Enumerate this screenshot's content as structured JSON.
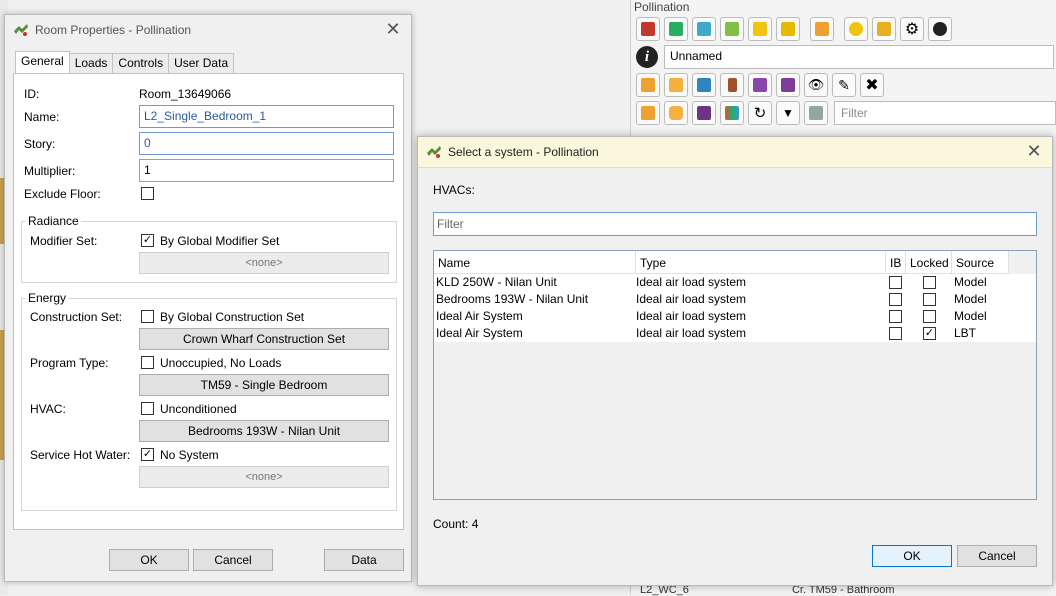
{
  "background": {
    "panel_title": "Pollination",
    "name_value": "Unnamed",
    "filter_placeholder": "Filter",
    "bottom_row_label": "L2_WC_6",
    "bottom_row_program": "Cr. TM59 - Bathroom",
    "toolbar_row1": [
      "room-icon",
      "face-icon",
      "aperture-icon",
      "shade-icon",
      "sensor-icon",
      "color-icon",
      "model-icon",
      "search-icon",
      "report-icon",
      "gear-icon",
      "help-book-icon"
    ],
    "toolbar_row2": [
      "add-room-icon",
      "add-face-icon",
      "add-aperture-icon",
      "add-door-icon",
      "add-shade-icon",
      "add-grid-icon",
      "view-icon",
      "edit-icon",
      "delete-icon"
    ],
    "toolbar_row3": [
      "room-select-icon",
      "hexagon-icon",
      "grid-icon",
      "color-grid-icon",
      "refresh-icon",
      "filter-icon",
      "model-box-icon"
    ]
  },
  "room_dialog": {
    "title": "Room Properties - Pollination",
    "tabs": [
      "General",
      "Loads",
      "Controls",
      "User Data"
    ],
    "id_label": "ID:",
    "id_value": "Room_13649066",
    "name_label": "Name:",
    "name_value": "L2_Single_Bedroom_1",
    "story_label": "Story:",
    "story_value": "0",
    "multiplier_label": "Multiplier:",
    "multiplier_value": "1",
    "exclude_floor_label": "Exclude Floor:",
    "exclude_floor_checked": false,
    "radiance": {
      "title": "Radiance",
      "modifier_set_label": "Modifier Set:",
      "modifier_set_check": "By Global Modifier Set",
      "modifier_set_checked": true,
      "modifier_set_button": "<none>"
    },
    "energy": {
      "title": "Energy",
      "construction_set_label": "Construction Set:",
      "construction_set_check": "By Global Construction Set",
      "construction_set_checked": false,
      "construction_set_button": "Crown Wharf Construction Set",
      "program_type_label": "Program Type:",
      "program_type_check": "Unoccupied, No Loads",
      "program_type_checked": false,
      "program_type_button": "TM59 - Single Bedroom",
      "hvac_label": "HVAC:",
      "hvac_check": "Unconditioned",
      "hvac_checked": false,
      "hvac_button": "Bedrooms 193W - Nilan Unit",
      "shw_label": "Service Hot Water:",
      "shw_check": "No System",
      "shw_checked": true,
      "shw_button": "<none>"
    },
    "ok_label": "OK",
    "cancel_label": "Cancel",
    "data_label": "Data"
  },
  "system_dialog": {
    "title": "Select a system - Pollination",
    "section_label": "HVACs:",
    "filter_placeholder": "Filter",
    "columns": [
      "Name",
      "Type",
      "IB",
      "Locked",
      "Source"
    ],
    "rows": [
      {
        "name": "KLD 250W - Nilan Unit",
        "type": "Ideal air load system",
        "ib": false,
        "locked": false,
        "source": "Model"
      },
      {
        "name": "Bedrooms 193W - Nilan Unit",
        "type": "Ideal air load system",
        "ib": false,
        "locked": false,
        "source": "Model"
      },
      {
        "name": "Ideal Air System",
        "type": "Ideal air load system",
        "ib": false,
        "locked": false,
        "source": "Model"
      },
      {
        "name": "Ideal Air System",
        "type": "Ideal air load system",
        "ib": false,
        "locked": true,
        "source": "LBT"
      }
    ],
    "count_label": "Count: 4",
    "ok_label": "OK",
    "cancel_label": "Cancel"
  },
  "colors": {
    "accent_blue": "#0078d7",
    "link_text": "#2c5aa0",
    "select_title_bg": "#f9f7dc"
  }
}
